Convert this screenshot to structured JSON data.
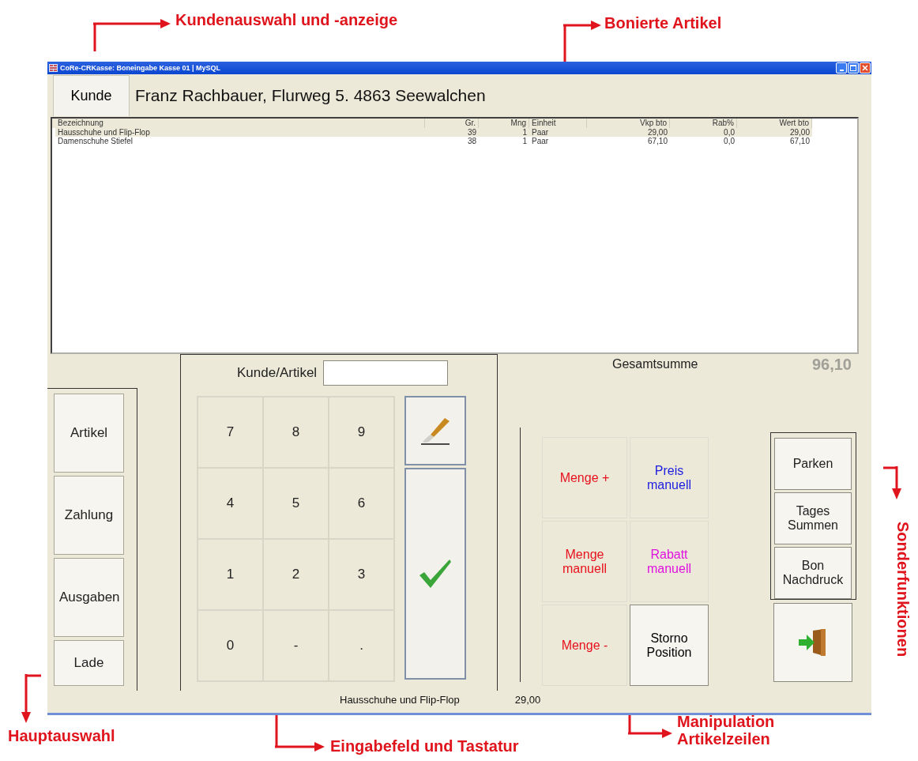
{
  "annotations": [
    {
      "text": "Kundenauswahl und -anzeige"
    },
    {
      "text": "Bonierte Artikel"
    },
    {
      "text": "Sonderfunktionen"
    },
    {
      "text": "Hauptauswahl"
    },
    {
      "text": "Eingabefeld und Tastatur"
    },
    {
      "text": "Manipulation Artikelzeilen"
    }
  ],
  "window": {
    "title": "CoRe-CRKasse: Boneingabe Kasse 01 | MySQL"
  },
  "customer": {
    "button": "Kunde",
    "name": "Franz Rachbauer, Flurweg 5. 4863 Seewalchen"
  },
  "table": {
    "columns": [
      "Bezeichnung",
      "Gr.",
      "Mng",
      "Einheit",
      "Vkp bto",
      "Rab%",
      "Wert bto"
    ],
    "rows": [
      {
        "cells": [
          "Hausschuhe und Flip-Flop",
          "39",
          "1",
          "Paar",
          "29,00",
          "0,0",
          "29,00"
        ],
        "selected": true
      },
      {
        "cells": [
          "Damenschuhe Stiefel",
          "38",
          "1",
          "Paar",
          "67,10",
          "0,0",
          "67,10"
        ],
        "selected": false
      }
    ]
  },
  "main_nav": [
    "Artikel",
    "Zahlung",
    "Ausgaben",
    "Lade"
  ],
  "input": {
    "label": "Kunde/Artikel"
  },
  "keypad": [
    "7",
    "8",
    "9",
    "4",
    "5",
    "6",
    "1",
    "2",
    "3",
    "0",
    "-",
    "."
  ],
  "total": {
    "label": "Gesamtsumme",
    "value": "96,10"
  },
  "manipulation": [
    {
      "label": "Menge +",
      "color": "#e8101c",
      "kind": "flat"
    },
    {
      "label": "Preis manuell",
      "color": "#1c1ce0",
      "kind": "flat"
    },
    {
      "label": "Menge manuell",
      "color": "#e8101c",
      "kind": "flat"
    },
    {
      "label": "Rabatt manuell",
      "color": "#e010e0",
      "kind": "flat"
    },
    {
      "label": "Menge -",
      "color": "#e8101c",
      "kind": "flat"
    },
    {
      "label": "Storno Position",
      "color": "#000000",
      "kind": "raised"
    }
  ],
  "special": [
    "Parken",
    "Tages Summen",
    "Bon Nachdruck"
  ],
  "status_bar": {
    "item": "Hausschuhe und Flip-Flop",
    "price": "29,00"
  }
}
